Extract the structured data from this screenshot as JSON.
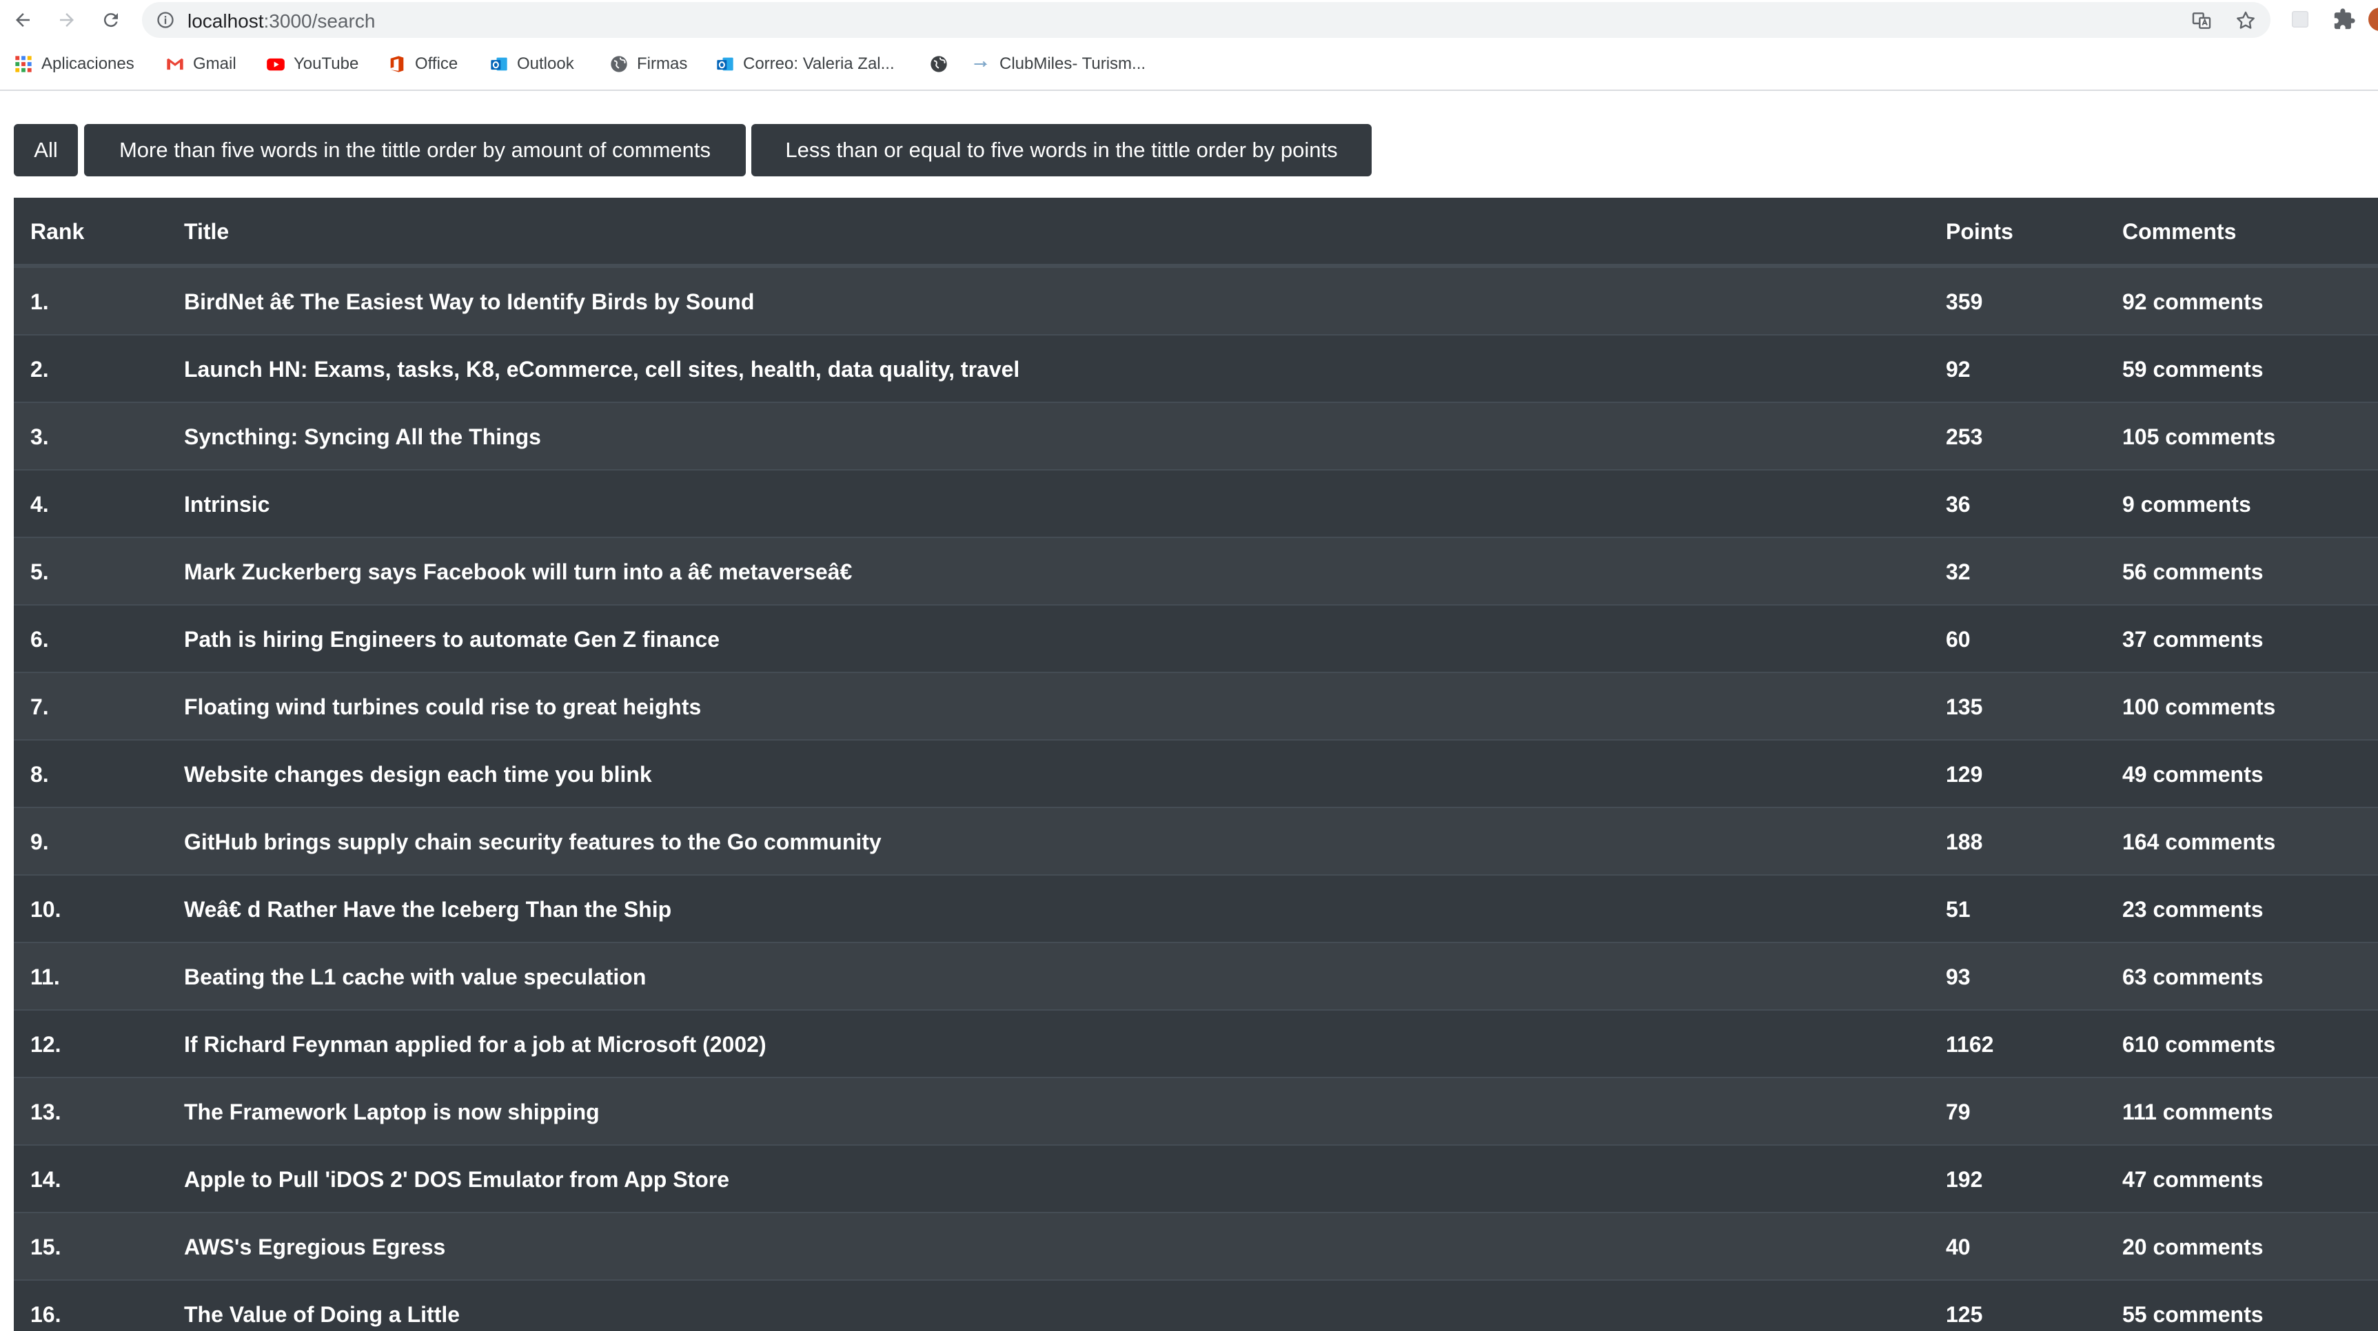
{
  "browser": {
    "url_host": "localhost",
    "url_path": ":3000/search",
    "bookmarks": [
      {
        "label": "Aplicaciones",
        "icon": "apps-grid-icon"
      },
      {
        "label": "Gmail",
        "icon": "gmail-icon"
      },
      {
        "label": "YouTube",
        "icon": "youtube-icon"
      },
      {
        "label": "Office",
        "icon": "office-icon"
      },
      {
        "label": "Outlook",
        "icon": "outlook-icon"
      },
      {
        "label": "Firmas",
        "icon": "globe-icon"
      },
      {
        "label": "Correo: Valeria Zal...",
        "icon": "outlook-icon"
      },
      {
        "label": "",
        "icon": "globe-icon"
      },
      {
        "label": "ClubMiles- Turism...",
        "icon": "clubmiles-icon"
      }
    ]
  },
  "filters": {
    "all_label": "All",
    "more_label": "More than five words in the tittle order by amount of comments",
    "less_label": "Less than or equal to five words in the tittle order by points"
  },
  "table": {
    "headers": {
      "rank": "Rank",
      "title": "Title",
      "points": "Points",
      "comments": "Comments"
    },
    "rows": [
      {
        "rank": "1.",
        "title": "BirdNet â€   The Easiest Way to Identify Birds by Sound",
        "points": "359",
        "comments": "92 comments"
      },
      {
        "rank": "2.",
        "title": "Launch HN: Exams, tasks, K8, eCommerce, cell sites, health, data quality, travel",
        "points": "92",
        "comments": "59 comments"
      },
      {
        "rank": "3.",
        "title": "Syncthing: Syncing All the Things",
        "points": "253",
        "comments": "105 comments"
      },
      {
        "rank": "4.",
        "title": "Intrinsic",
        "points": "36",
        "comments": "9 comments"
      },
      {
        "rank": "5.",
        "title": "Mark Zuckerberg says Facebook will turn into a â€   metaverseâ€",
        "points": "32",
        "comments": "56 comments"
      },
      {
        "rank": "6.",
        "title": "Path is hiring Engineers to automate Gen Z finance",
        "points": "60",
        "comments": "37 comments"
      },
      {
        "rank": "7.",
        "title": "Floating wind turbines could rise to great heights",
        "points": "135",
        "comments": "100 comments"
      },
      {
        "rank": "8.",
        "title": "Website changes design each time you blink",
        "points": "129",
        "comments": "49 comments"
      },
      {
        "rank": "9.",
        "title": "GitHub brings supply chain security features to the Go community",
        "points": "188",
        "comments": "164 comments"
      },
      {
        "rank": "10.",
        "title": "Weâ€   d Rather Have the Iceberg Than the Ship",
        "points": "51",
        "comments": "23 comments"
      },
      {
        "rank": "11.",
        "title": "Beating the L1 cache with value speculation",
        "points": "93",
        "comments": "63 comments"
      },
      {
        "rank": "12.",
        "title": "If Richard Feynman applied for a job at Microsoft (2002)",
        "points": "1162",
        "comments": "610 comments"
      },
      {
        "rank": "13.",
        "title": "The Framework Laptop is now shipping",
        "points": "79",
        "comments": "111 comments"
      },
      {
        "rank": "14.",
        "title": "Apple to Pull 'iDOS 2' DOS Emulator from App Store",
        "points": "192",
        "comments": "47 comments"
      },
      {
        "rank": "15.",
        "title": "AWS's Egregious Egress",
        "points": "40",
        "comments": "20 comments"
      },
      {
        "rank": "16.",
        "title": "The Value of Doing a Little",
        "points": "125",
        "comments": "55 comments"
      }
    ]
  }
}
